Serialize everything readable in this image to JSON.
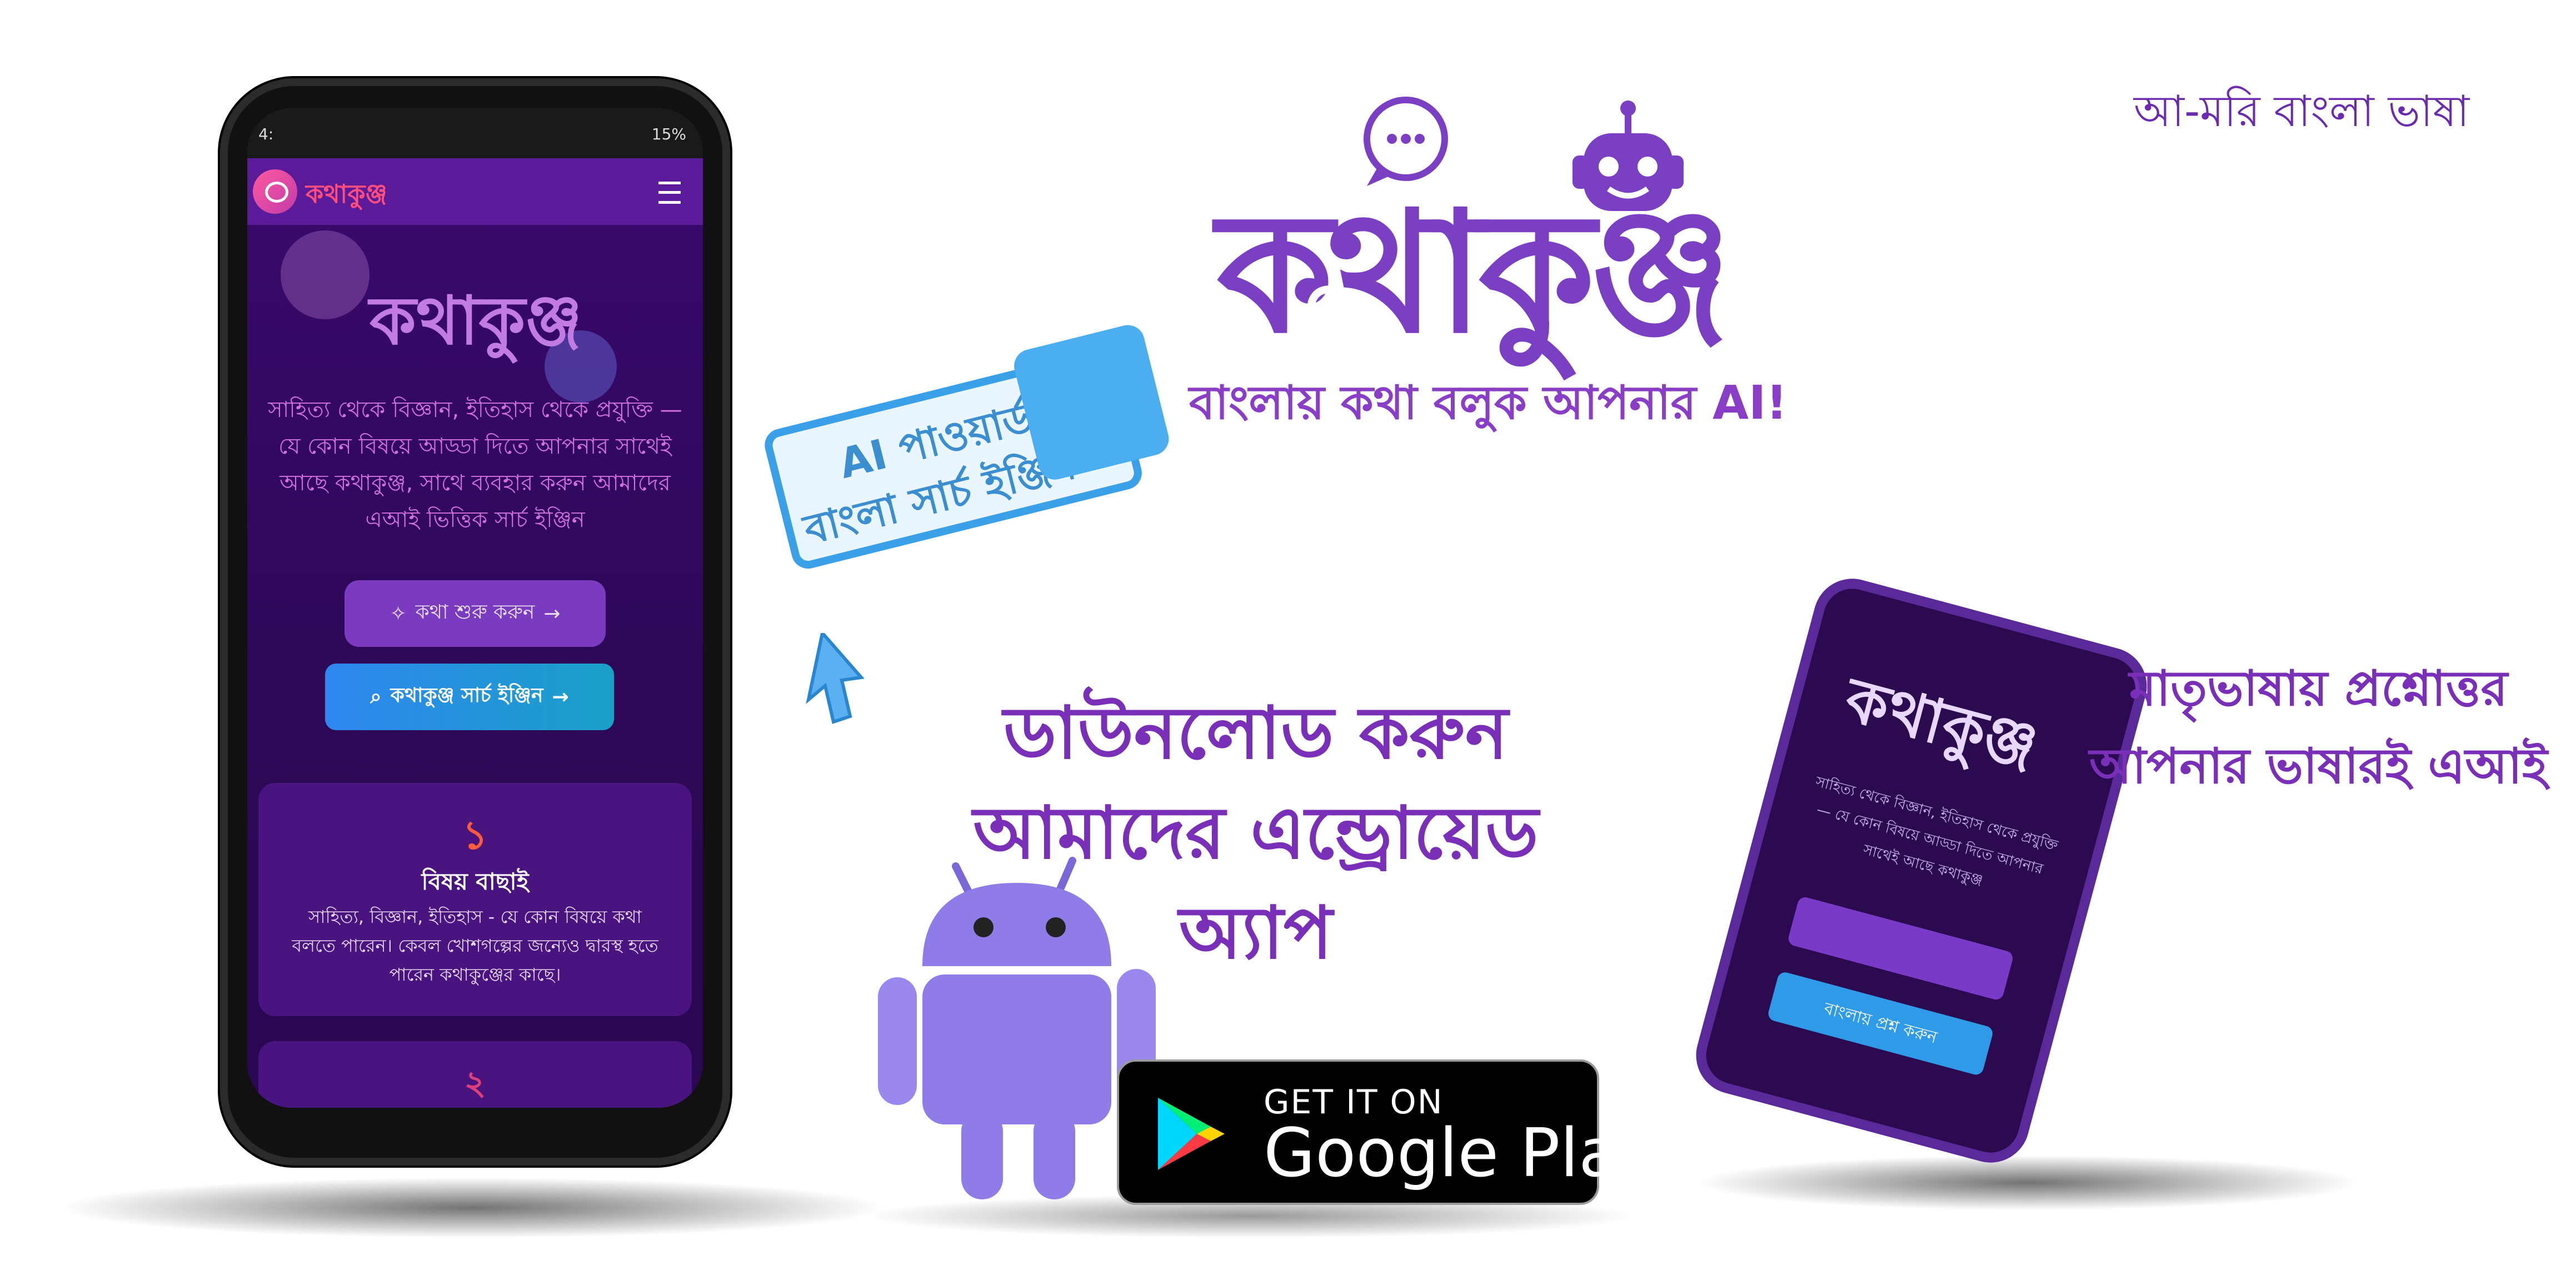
{
  "tagline": "আ-মরি বাংলা ভাষা",
  "brand": {
    "name": "কথাকুঞ্জ",
    "subtitle": "বাংলায় কথা বলুক আপনার AI!"
  },
  "phone": {
    "status_time": "4:",
    "status_battery": "15%",
    "nav_title": "কথাকুঞ্জ",
    "logo": "কথাকুঞ্জ",
    "description": "সাহিত্য থেকে বিজ্ঞান, ইতিহাস থেকে প্রযুক্তি — যে কোন বিষয়ে আড্ডা দিতে আপনার সাথেই আছে কথাকুঞ্জ, সাথে ব্যবহার করুন আমাদের এআই ভিত্তিক সার্চ ইঞ্জিন",
    "start_button": "কথা শুরু করুন",
    "search_button": "কথাকুঞ্জ সার্চ ইঞ্জিন",
    "card": {
      "number": "১",
      "title": "বিষয় বাছাই",
      "body": "সাহিত্য, বিজ্ঞান, ইতিহাস - যে কোন বিষয়ে কথা বলতে পারেন। কেবল খোশগল্পের জন্যেও দ্বারস্থ হতে পারেন কথাকুঞ্জের কাছে।"
    },
    "card2_number": "২"
  },
  "search_badge": {
    "line1": "AI পাওয়ার্ড",
    "line2": "বাংলা সার্চ ইঞ্জিন"
  },
  "download": {
    "line1": "ডাউনলোড করুন",
    "line2": "আমাদের এন্ড্রোয়েড",
    "line3": "অ্যাপ"
  },
  "google_play": {
    "small": "GET IT ON",
    "big": "Google Play"
  },
  "right_phone": {
    "logo": "কথাকুঞ্জ",
    "text": "সাহিত্য থেকে বিজ্ঞান, ইতিহাস থেকে প্রযুক্তি — যে কোন বিষয়ে আড্ডা দিতে আপনার সাথেই আছে কথাকুঞ্জ",
    "button": "বাংলায় প্রশ্ন করুন"
  },
  "right_text": {
    "line1": "মাতৃভাষায় প্রশ্নোত্তর",
    "line2": "আপনার ভাষারই এআই"
  },
  "colors": {
    "brand_purple": "#7b3fc4",
    "accent_blue": "#2f86f0",
    "accent_red": "#ff4d7e"
  }
}
